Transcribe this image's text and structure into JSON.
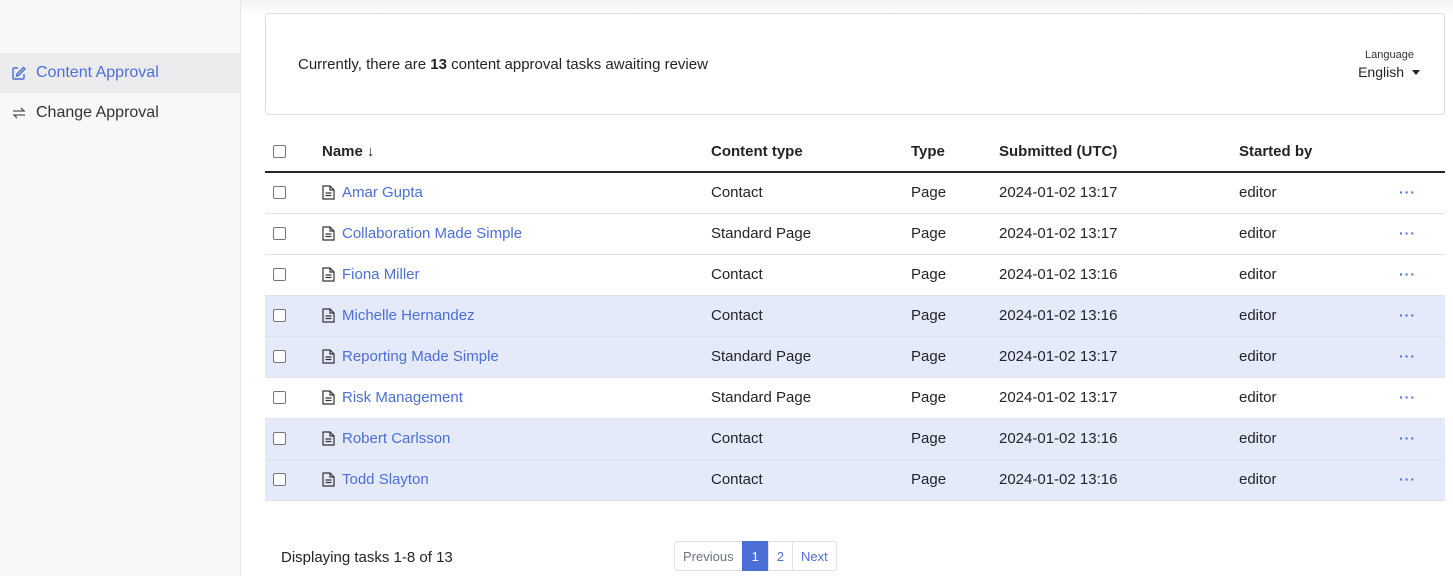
{
  "sidebar": {
    "items": [
      {
        "label": "Content Approval",
        "icon": "edit-icon",
        "active": true
      },
      {
        "label": "Change Approval",
        "icon": "swap-arrows-icon",
        "active": false
      }
    ]
  },
  "summary": {
    "prefix": "Currently, there are",
    "count": "13",
    "suffix": "content approval tasks awaiting review",
    "language_label": "Language",
    "language_value": "English"
  },
  "table": {
    "headers": {
      "name": "Name",
      "sort_indicator": "↓",
      "content_type": "Content type",
      "type": "Type",
      "submitted": "Submitted (UTC)",
      "started_by": "Started by"
    },
    "rows": [
      {
        "name": "Amar Gupta",
        "content_type": "Contact",
        "type": "Page",
        "submitted": "2024-01-02 13:17",
        "started_by": "editor",
        "actions": "···"
      },
      {
        "name": "Collaboration Made Simple",
        "content_type": "Standard Page",
        "type": "Page",
        "submitted": "2024-01-02 13:17",
        "started_by": "editor",
        "actions": "···"
      },
      {
        "name": "Fiona Miller",
        "content_type": "Contact",
        "type": "Page",
        "submitted": "2024-01-02 13:16",
        "started_by": "editor",
        "actions": "···"
      },
      {
        "name": "Michelle Hernandez",
        "content_type": "Contact",
        "type": "Page",
        "submitted": "2024-01-02 13:16",
        "started_by": "editor",
        "actions": "···"
      },
      {
        "name": "Reporting Made Simple",
        "content_type": "Standard Page",
        "type": "Page",
        "submitted": "2024-01-02 13:17",
        "started_by": "editor",
        "actions": "···"
      },
      {
        "name": "Risk Management",
        "content_type": "Standard Page",
        "type": "Page",
        "submitted": "2024-01-02 13:17",
        "started_by": "editor",
        "actions": "···"
      },
      {
        "name": "Robert Carlsson",
        "content_type": "Contact",
        "type": "Page",
        "submitted": "2024-01-02 13:16",
        "started_by": "editor",
        "actions": "···"
      },
      {
        "name": "Todd Slayton",
        "content_type": "Contact",
        "type": "Page",
        "submitted": "2024-01-02 13:16",
        "started_by": "editor",
        "actions": "···"
      }
    ]
  },
  "footer": {
    "display_text": "Displaying tasks 1-8 of 13",
    "pagination": {
      "previous": "Previous",
      "pages": [
        "1",
        "2"
      ],
      "current": "1",
      "next": "Next"
    }
  },
  "colors": {
    "accent": "#4c6fd7",
    "row_highlight": "#e5eafb",
    "sidebar_bg": "#f8f8f9"
  }
}
